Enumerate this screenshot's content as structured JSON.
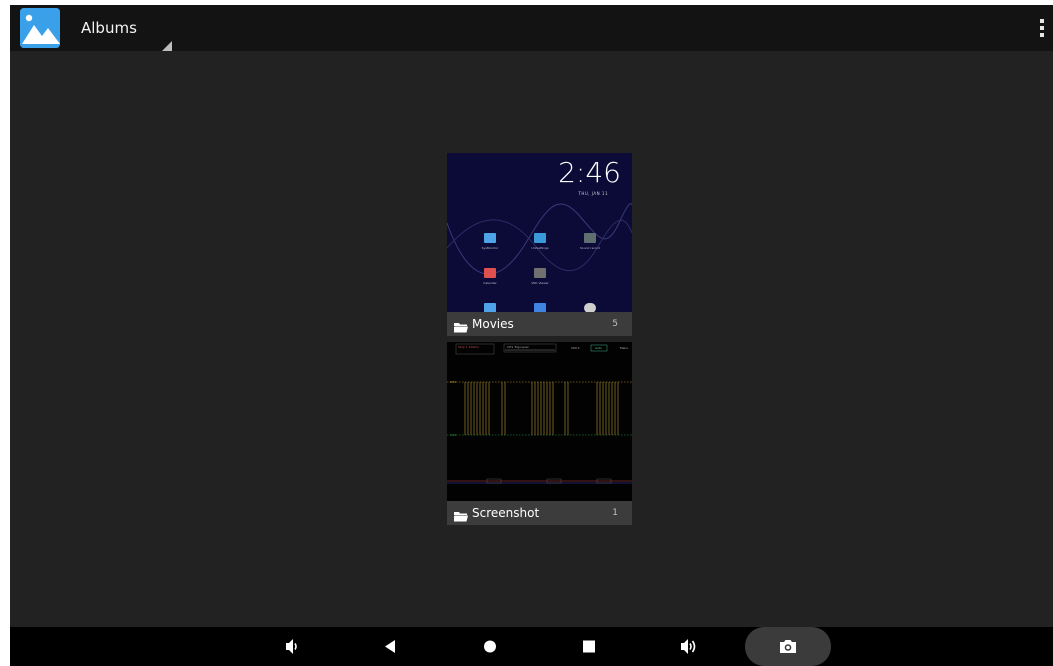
{
  "action_bar": {
    "app_icon": "gallery-icon",
    "title": "Albums",
    "dropdown_icon": "dropdown-triangle-icon",
    "overflow_icon": "overflow-menu-icon"
  },
  "albums": [
    {
      "name": "Movies",
      "count": "5",
      "icon": "folder-icon",
      "thumbnail": {
        "kind": "home-screen",
        "clock": "2:46",
        "date": "THU, JAN 11",
        "apps": [
          "SysMonitor",
          "UniSettings",
          "Sound record",
          "Calendar",
          "VNC Viewer"
        ]
      }
    },
    {
      "name": "Screenshot",
      "count": "1",
      "icon": "folder-icon",
      "thumbnail": {
        "kind": "oscilloscope",
        "readouts": [
          "Stop 1 100ms",
          "CH1 Trig Level",
          "200 S",
          "Auto",
          "Menu",
          "CH1",
          "CH2"
        ]
      }
    }
  ],
  "nav_bar": {
    "buttons": [
      "volume-down-icon",
      "back-icon",
      "home-icon",
      "recents-icon",
      "volume-up-icon",
      "screenshot-camera-icon"
    ]
  },
  "colors": {
    "screen_bg": "#222222",
    "action_bar_bg": "#131313",
    "label_bar_bg": "#3c3c3c",
    "accent_blue": "#3aa0ea",
    "nav_bg": "#000000"
  }
}
